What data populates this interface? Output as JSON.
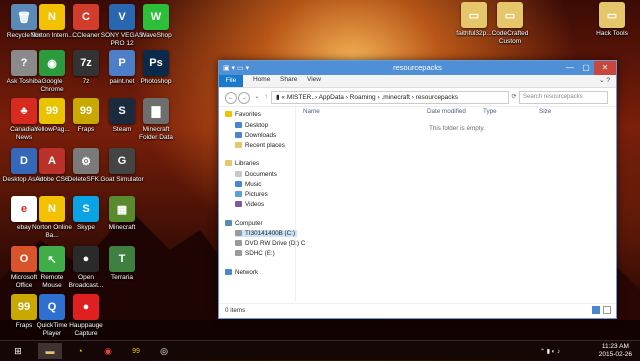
{
  "desktop_icons": [
    {
      "id": "recycle-bin",
      "label": "Recycle Bin",
      "glyph": "🗑",
      "color": "#5a8bb8"
    },
    {
      "id": "norton-internet",
      "label": "Norton Intern...",
      "glyph": "N",
      "color": "#f2c200"
    },
    {
      "id": "ccleaner",
      "label": "CCleaner",
      "glyph": "C",
      "color": "#d23c2c"
    },
    {
      "id": "sony-vegas",
      "label": "SONY VEGAS PRO 12",
      "glyph": "V",
      "color": "#2a67b1"
    },
    {
      "id": "waveshop",
      "label": "WaveShop",
      "glyph": "W",
      "color": "#2bbf3a"
    },
    {
      "id": "ask-toshiba",
      "label": "Ask Toshiba",
      "glyph": "?",
      "color": "#8a8a8a"
    },
    {
      "id": "google-chrome",
      "label": "Google Chrome",
      "glyph": "◉",
      "color": "#2c9b3d"
    },
    {
      "id": "7z",
      "label": "7z",
      "glyph": "7z",
      "color": "#333333"
    },
    {
      "id": "paint-net",
      "label": "paint.net",
      "glyph": "P",
      "color": "#4c7fc7"
    },
    {
      "id": "photoshop",
      "label": "Photoshop",
      "glyph": "Ps",
      "color": "#0b2a4a"
    },
    {
      "id": "canadian-news",
      "label": "Canadian News",
      "glyph": "♣",
      "color": "#d72b20"
    },
    {
      "id": "yellowpages",
      "label": "YellowPag...",
      "glyph": "99",
      "color": "#e8c400"
    },
    {
      "id": "fraps-1",
      "label": "Fraps",
      "glyph": "99",
      "color": "#c9a800"
    },
    {
      "id": "steam",
      "label": "Steam",
      "glyph": "S",
      "color": "#1b2a3c"
    },
    {
      "id": "minecraft-folder-data",
      "label": "Minecraft Folder Data",
      "glyph": "▇",
      "color": "#6e6e6e"
    },
    {
      "id": "desktop-assist",
      "label": "Desktop Assist",
      "glyph": "D",
      "color": "#3568b8"
    },
    {
      "id": "adobe-cs6",
      "label": "Adobe CS6",
      "glyph": "A",
      "color": "#b8322a"
    },
    {
      "id": "deletesfk",
      "label": "DeleteSFK...",
      "glyph": "⚙",
      "color": "#7a7a7a"
    },
    {
      "id": "goat-simulator",
      "label": "Goat Simulator",
      "glyph": "G",
      "color": "#444444"
    },
    {
      "id": "ebay",
      "label": "ebay",
      "glyph": "e",
      "color": "#ffffff"
    },
    {
      "id": "norton-online-backup",
      "label": "Norton Online Ba...",
      "glyph": "N",
      "color": "#f2c200"
    },
    {
      "id": "skype",
      "label": "Skype",
      "glyph": "S",
      "color": "#0aa3e3"
    },
    {
      "id": "minecraft",
      "label": "Minecraft",
      "glyph": "▦",
      "color": "#5a8a2e"
    },
    {
      "id": "microsoft-office",
      "label": "Microsoft Office",
      "glyph": "O",
      "color": "#d9532b"
    },
    {
      "id": "remote-mouse",
      "label": "Remote Mouse",
      "glyph": "↖",
      "color": "#3fae49"
    },
    {
      "id": "open-broadcaster",
      "label": "Open Broadcast...",
      "glyph": "●",
      "color": "#2a2a2a"
    },
    {
      "id": "terraria",
      "label": "Terraria",
      "glyph": "T",
      "color": "#3f7f3f"
    },
    {
      "id": "fraps-2",
      "label": "Fraps",
      "glyph": "99",
      "color": "#c9a800"
    },
    {
      "id": "quicktime",
      "label": "QuickTime Player",
      "glyph": "Q",
      "color": "#2f6fd0"
    },
    {
      "id": "hauppauge",
      "label": "Hauppauge Capture",
      "glyph": "●",
      "color": "#e02020"
    },
    {
      "id": "faithful-32pack",
      "label": "faithful32p...",
      "glyph": "▭",
      "color": "#e6c66a"
    },
    {
      "id": "codecrafted",
      "label": "CodeCrafted Custom",
      "glyph": "▭",
      "color": "#e6c66a"
    },
    {
      "id": "hack-tools",
      "label": "Hack Tools",
      "glyph": "▭",
      "color": "#e6c66a"
    }
  ],
  "explorer": {
    "title": "resourcepacks",
    "ribbon_tabs": [
      "File",
      "Home",
      "Share",
      "View"
    ],
    "address_path": "MISTER..› AppData › Roaming › .minecraft › resourcepacks",
    "search_placeholder": "Search resourcepacks",
    "columns": [
      "Name",
      "Date modified",
      "Type",
      "Size"
    ],
    "empty_message": "This folder is empty.",
    "status_text": "0 items",
    "nav": {
      "favorites_header": "Favorites",
      "favorites": [
        "Desktop",
        "Downloads",
        "Recent places"
      ],
      "libraries_header": "Libraries",
      "libraries": [
        "Documents",
        "Music",
        "Pictures",
        "Videos"
      ],
      "computer_header": "Computer",
      "drives": [
        "TI30141400B (C:)",
        "DVD RW Drive (D:) C",
        "SDHC (E:)"
      ],
      "network": "Network"
    }
  },
  "taskbar": {
    "time": "11:23 AM",
    "date": "2015-02-26"
  }
}
